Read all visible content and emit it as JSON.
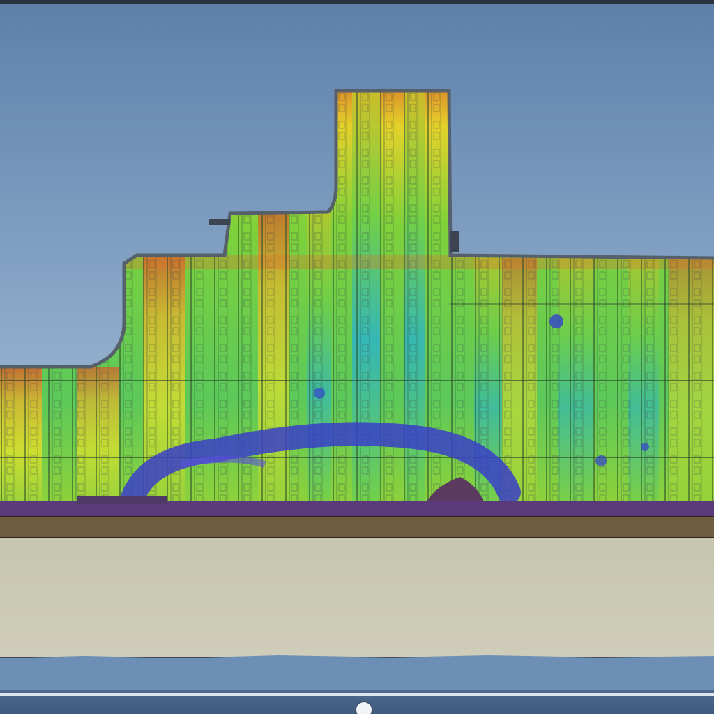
{
  "viewer": {
    "playback_progress": 0.51
  },
  "colors": {
    "sky_top": "#6c8fb8",
    "sky_bottom": "#a4bdd6",
    "facade_green": "#7fd13a",
    "facade_yellow": "#e4e22a",
    "facade_orange": "#d98a2a",
    "facade_cyan": "#2bbcc4",
    "moisture_blue": "#3344cc",
    "ground_purple": "#5a3a7a",
    "ground_brown": "#6b5a3e",
    "field_beige": "#c9c8b2",
    "water_blue": "#6d8fb5"
  }
}
